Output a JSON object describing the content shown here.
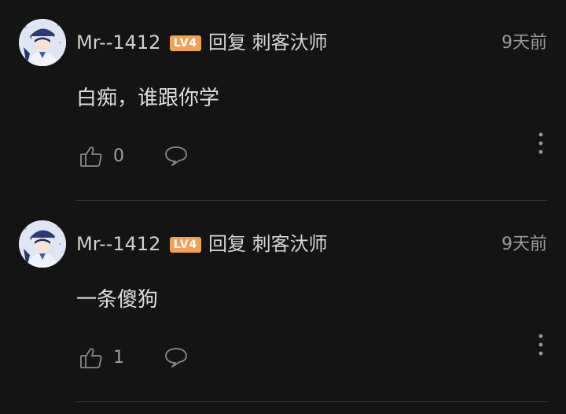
{
  "comments": [
    {
      "username": "Mr--1412",
      "level": "LV4",
      "reply_label": "回复 刺客汏师",
      "time": "9天前",
      "content": "白痴，谁跟你学",
      "likes": "0"
    },
    {
      "username": "Mr--1412",
      "level": "LV4",
      "reply_label": "回复 刺客汏师",
      "time": "9天前",
      "content": "一条傻狗",
      "likes": "1"
    }
  ],
  "icons": {
    "like": "thumbs-up-icon",
    "reply": "speech-bubble-icon",
    "more": "more-vertical-icon"
  },
  "colors": {
    "background": "#141414",
    "level_badge": "#f0a155",
    "divider": "#3a3a3a"
  }
}
